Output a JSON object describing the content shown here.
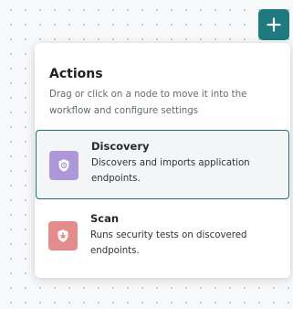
{
  "add_button": {
    "icon": "plus-icon",
    "color": "#1f7a80"
  },
  "panel": {
    "title": "Actions",
    "description": "Drag or click on a node to move it into the workflow and configure settings"
  },
  "nodes": [
    {
      "title": "Discovery",
      "description": "Discovers and imports application endpoints.",
      "icon": "shield-gear-icon",
      "icon_color": "#ad97d8",
      "selected": true
    },
    {
      "title": "Scan",
      "description": "Runs security tests on discovered endpoints.",
      "icon": "shield-bug-icon",
      "icon_color": "#e48c8c",
      "selected": false
    }
  ]
}
